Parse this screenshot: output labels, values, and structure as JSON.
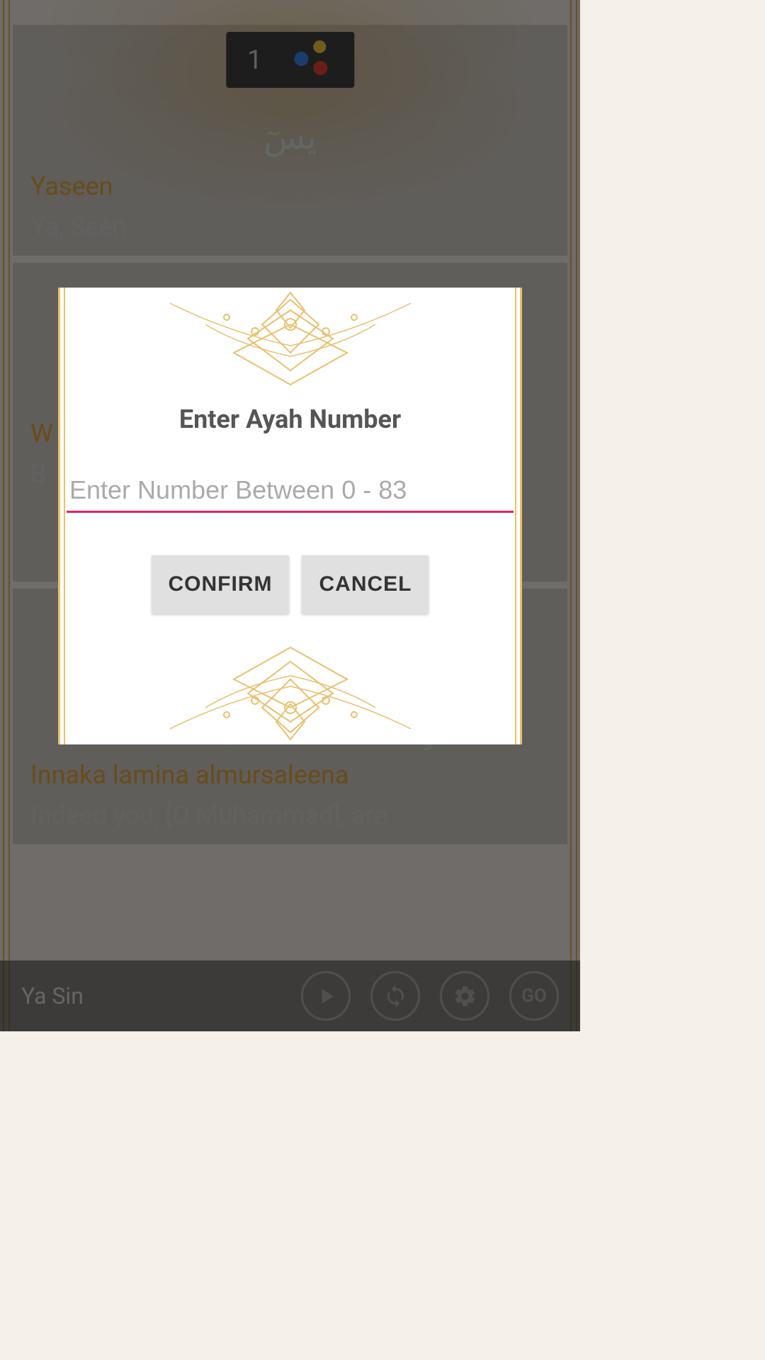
{
  "page": {
    "pageNumber": "1"
  },
  "verses": [
    {
      "arabic": "يسٓ",
      "transliteration": "Yaseen",
      "translation": "Ya, Seen."
    },
    {
      "arabic": "",
      "transliteration": "W",
      "translation": "B"
    },
    {
      "arabic": "إِنَّكَ لَمِنَ ٱلْمُرْسَلِينَ",
      "transliteration": "Innaka lamina almursaleena",
      "translation": "Indeed you, [O Muhammad], are"
    }
  ],
  "bottomBar": {
    "surahName": "Ya Sin"
  },
  "dialog": {
    "title": "Enter Ayah Number",
    "placeholder": "Enter Number Between 0 - 83",
    "confirmLabel": "CONFIRM",
    "cancelLabel": "CANCEL"
  },
  "icons": {
    "play": "play",
    "repeat": "repeat",
    "settings": "settings",
    "go": "GO"
  }
}
